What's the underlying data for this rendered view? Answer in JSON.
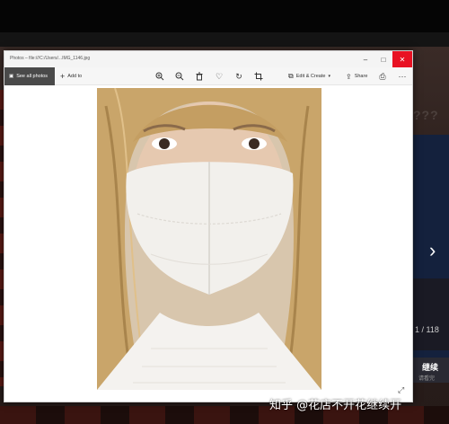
{
  "window": {
    "title": "Photos – file:///C:/Users/...IMG_1146.jpg",
    "close_glyph": "✕"
  },
  "toolbar": {
    "see_all_photos": "See all photos",
    "add_to": "Add to",
    "edit_create": "Edit & Create",
    "share": "Share",
    "more": "···",
    "icons": [
      "zoom-in-icon",
      "zoom-out-icon",
      "delete-icon",
      "heart-icon",
      "rotate-icon",
      "crop-icon",
      "print-icon"
    ]
  },
  "background": {
    "counter": "1 / 118",
    "next_glyph": "›",
    "button_label": "继续",
    "button_sub": "请看完"
  },
  "watermark": "知乎 @花店不开花继续开",
  "colors": {
    "close_red": "#e81123",
    "see_all_bg": "#4a4a4a",
    "background_game": "#2c1f1c"
  }
}
